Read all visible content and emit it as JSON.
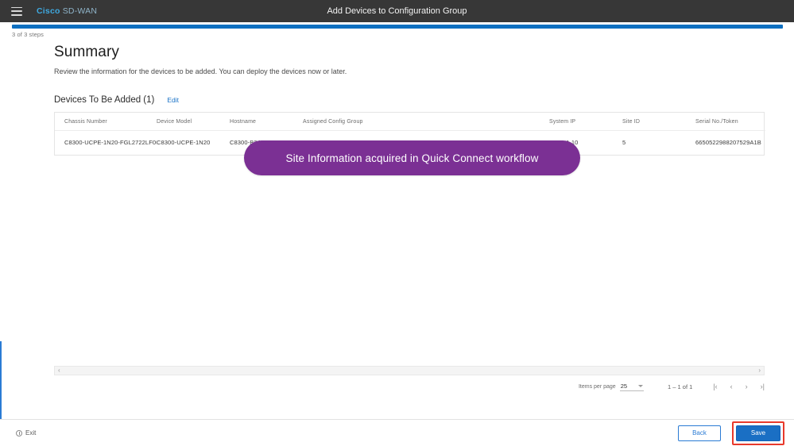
{
  "topbar": {
    "menu_icon": "hamburger-icon",
    "brand_primary": "Cisco",
    "brand_secondary": "SD-WAN",
    "title": "Add Devices to Configuration Group"
  },
  "progress": {
    "percent": 100,
    "steps_label": "3 of 3 steps",
    "fill_color": "#0d6fc0"
  },
  "page": {
    "title": "Summary",
    "subtitle": "Review the information for the devices to be added. You can deploy the devices now or later."
  },
  "section": {
    "title": "Devices To Be Added (1)",
    "edit_label": "Edit"
  },
  "table": {
    "columns": [
      "Chassis Number",
      "Device Model",
      "Hostname",
      "Assigned Config Group",
      "System IP",
      "Site ID",
      "Serial No./Token"
    ],
    "rows": [
      [
        "C8300-UCPE-1N20-FGL2722LF0B",
        "C8300-UCPE-1N20",
        "C8300-B24",
        "-",
        "100.1.1.10",
        "5",
        "6650522988207529A1B"
      ]
    ]
  },
  "callout": {
    "text": "Site Information acquired in Quick Connect workflow",
    "color": "#7b3094"
  },
  "scrollbar": {
    "left_arrow": "‹",
    "right_arrow": "›"
  },
  "pagination": {
    "items_per_page_label": "Items per page",
    "items_per_page_value": "25",
    "range_label": "1 – 1 of 1",
    "first_page": "|‹",
    "prev_page": "‹",
    "next_page": "›",
    "last_page": "›|"
  },
  "footer": {
    "exit_label": "Exit",
    "back_label": "Back",
    "save_label": "Save",
    "save_highlight_color": "#e8392b"
  }
}
